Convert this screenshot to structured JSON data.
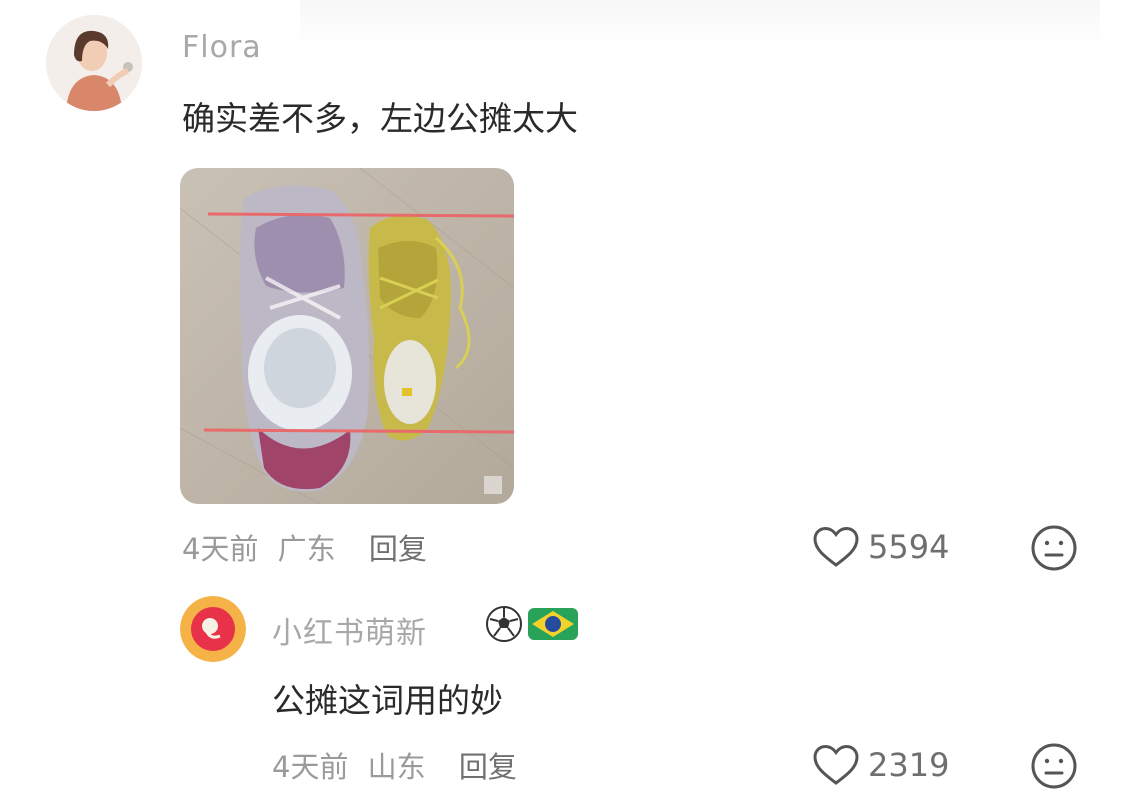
{
  "comment": {
    "username": "Flora",
    "text": "确实差不多，左边公摊太大",
    "time": "4天前",
    "location": "广东",
    "reply_label": "回复",
    "likes": "5594"
  },
  "reply": {
    "username": "小红书萌新",
    "badges": [
      "soccer-ball-icon",
      "brazil-flag-icon"
    ],
    "text": "公摊这词用的妙",
    "time": "4天前",
    "location": "山东",
    "reply_label": "回复",
    "likes": "2319"
  },
  "colors": {
    "text_main": "#2a2a2a",
    "text_muted": "#9a9a9a",
    "highlight_line": "#e86a6a"
  }
}
